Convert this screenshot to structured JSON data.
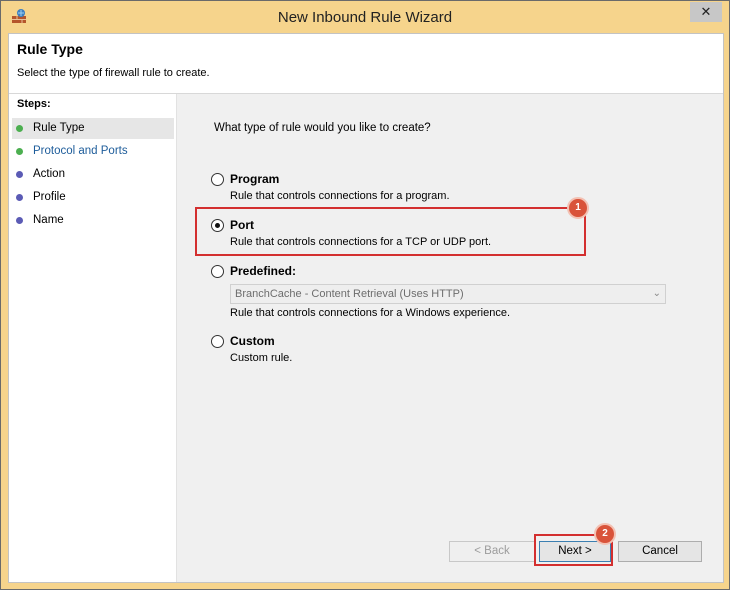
{
  "window": {
    "title": "New Inbound Rule Wizard",
    "close_glyph": "✕"
  },
  "header": {
    "title": "Rule Type",
    "description": "Select the type of firewall rule to create."
  },
  "steps": {
    "heading": "Steps:",
    "items": [
      {
        "label": "Rule Type",
        "status": "done",
        "dot_color": "#4caf50"
      },
      {
        "label": "Protocol and Ports",
        "status": "done",
        "dot_color": "#4caf50"
      },
      {
        "label": "Action",
        "status": "pending",
        "dot_color": "#5b5bb5"
      },
      {
        "label": "Profile",
        "status": "pending",
        "dot_color": "#5b5bb5"
      },
      {
        "label": "Name",
        "status": "pending",
        "dot_color": "#5b5bb5"
      }
    ]
  },
  "main": {
    "question": "What type of rule would you like to create?",
    "options": [
      {
        "title": "Program",
        "description": "Rule that controls connections for a program.",
        "selected": false
      },
      {
        "title": "Port",
        "description": "Rule that controls connections for a TCP or UDP port.",
        "selected": true
      },
      {
        "title": "Predefined:",
        "description": "Rule that controls connections for a Windows experience.",
        "selected": false,
        "dropdown_value": "BranchCache - Content Retrieval (Uses HTTP)"
      },
      {
        "title": "Custom",
        "description": "Custom rule.",
        "selected": false
      }
    ]
  },
  "buttons": {
    "back": "< Back",
    "next": "Next >",
    "cancel": "Cancel"
  },
  "annotations": {
    "badge1": "1",
    "badge2": "2",
    "highlight_color": "#d32f2f"
  }
}
